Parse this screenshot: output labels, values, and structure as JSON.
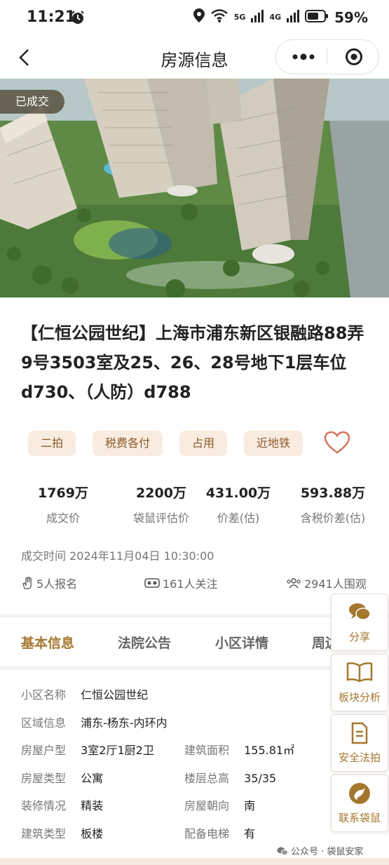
{
  "status_bar": {
    "time": "11:21",
    "network_5g": "5G",
    "network_4g": "4G",
    "battery": "59%"
  },
  "header": {
    "title": "房源信息",
    "more_icon": "more-icon",
    "close_icon": "target-icon"
  },
  "photo": {
    "badge": "已成交"
  },
  "property": {
    "title": "【仁恒公园世纪】上海市浦东新区银融路88弄9号3503室及25、26、28号地下1层车位d730、（人防）d788",
    "tags": [
      "二拍",
      "税费各付",
      "占用",
      "近地铁"
    ],
    "stats": [
      {
        "value": "1769万",
        "label": "成交价"
      },
      {
        "value": "2200万",
        "label": "袋鼠评估价"
      },
      {
        "value": "431.00万",
        "label": "价差(估)"
      },
      {
        "value": "593.88万",
        "label": "含税价差(估)"
      }
    ],
    "deal_time": "成交时间 2024年11月04日 10:30:00",
    "signups": "5人报名",
    "followers": "161人关注",
    "viewers": "2941人围观"
  },
  "tabs": [
    "基本信息",
    "法院公告",
    "小区详情",
    "周边"
  ],
  "basic_info": {
    "community_label": "小区名称",
    "community": "仁恒公园世纪",
    "area_label": "区域信息",
    "area": "浦东-杨东-内环内",
    "layout_label": "房屋户型",
    "layout": "3室2厅1厨2卫",
    "floor_area_label": "建筑面积",
    "floor_area": "155.81㎡",
    "house_type_label": "房屋类型",
    "house_type": "公寓",
    "floors_label": "楼层总高",
    "floors": "35/35",
    "decoration_label": "装修情况",
    "decoration": "精装",
    "orientation_label": "房屋朝向",
    "orientation": "南",
    "building_type_label": "建筑类型",
    "building_type": "板楼",
    "elevator_label": "配备电梯",
    "elevator": "有"
  },
  "side_buttons": [
    "分享",
    "板块分析",
    "安全法拍",
    "联系袋鼠"
  ],
  "watermark": "公众号 · 袋鼠安家",
  "colors": {
    "accent": "#a4772f",
    "tag_bg": "#f8ebe0",
    "tag_text": "#8b5a2b"
  }
}
